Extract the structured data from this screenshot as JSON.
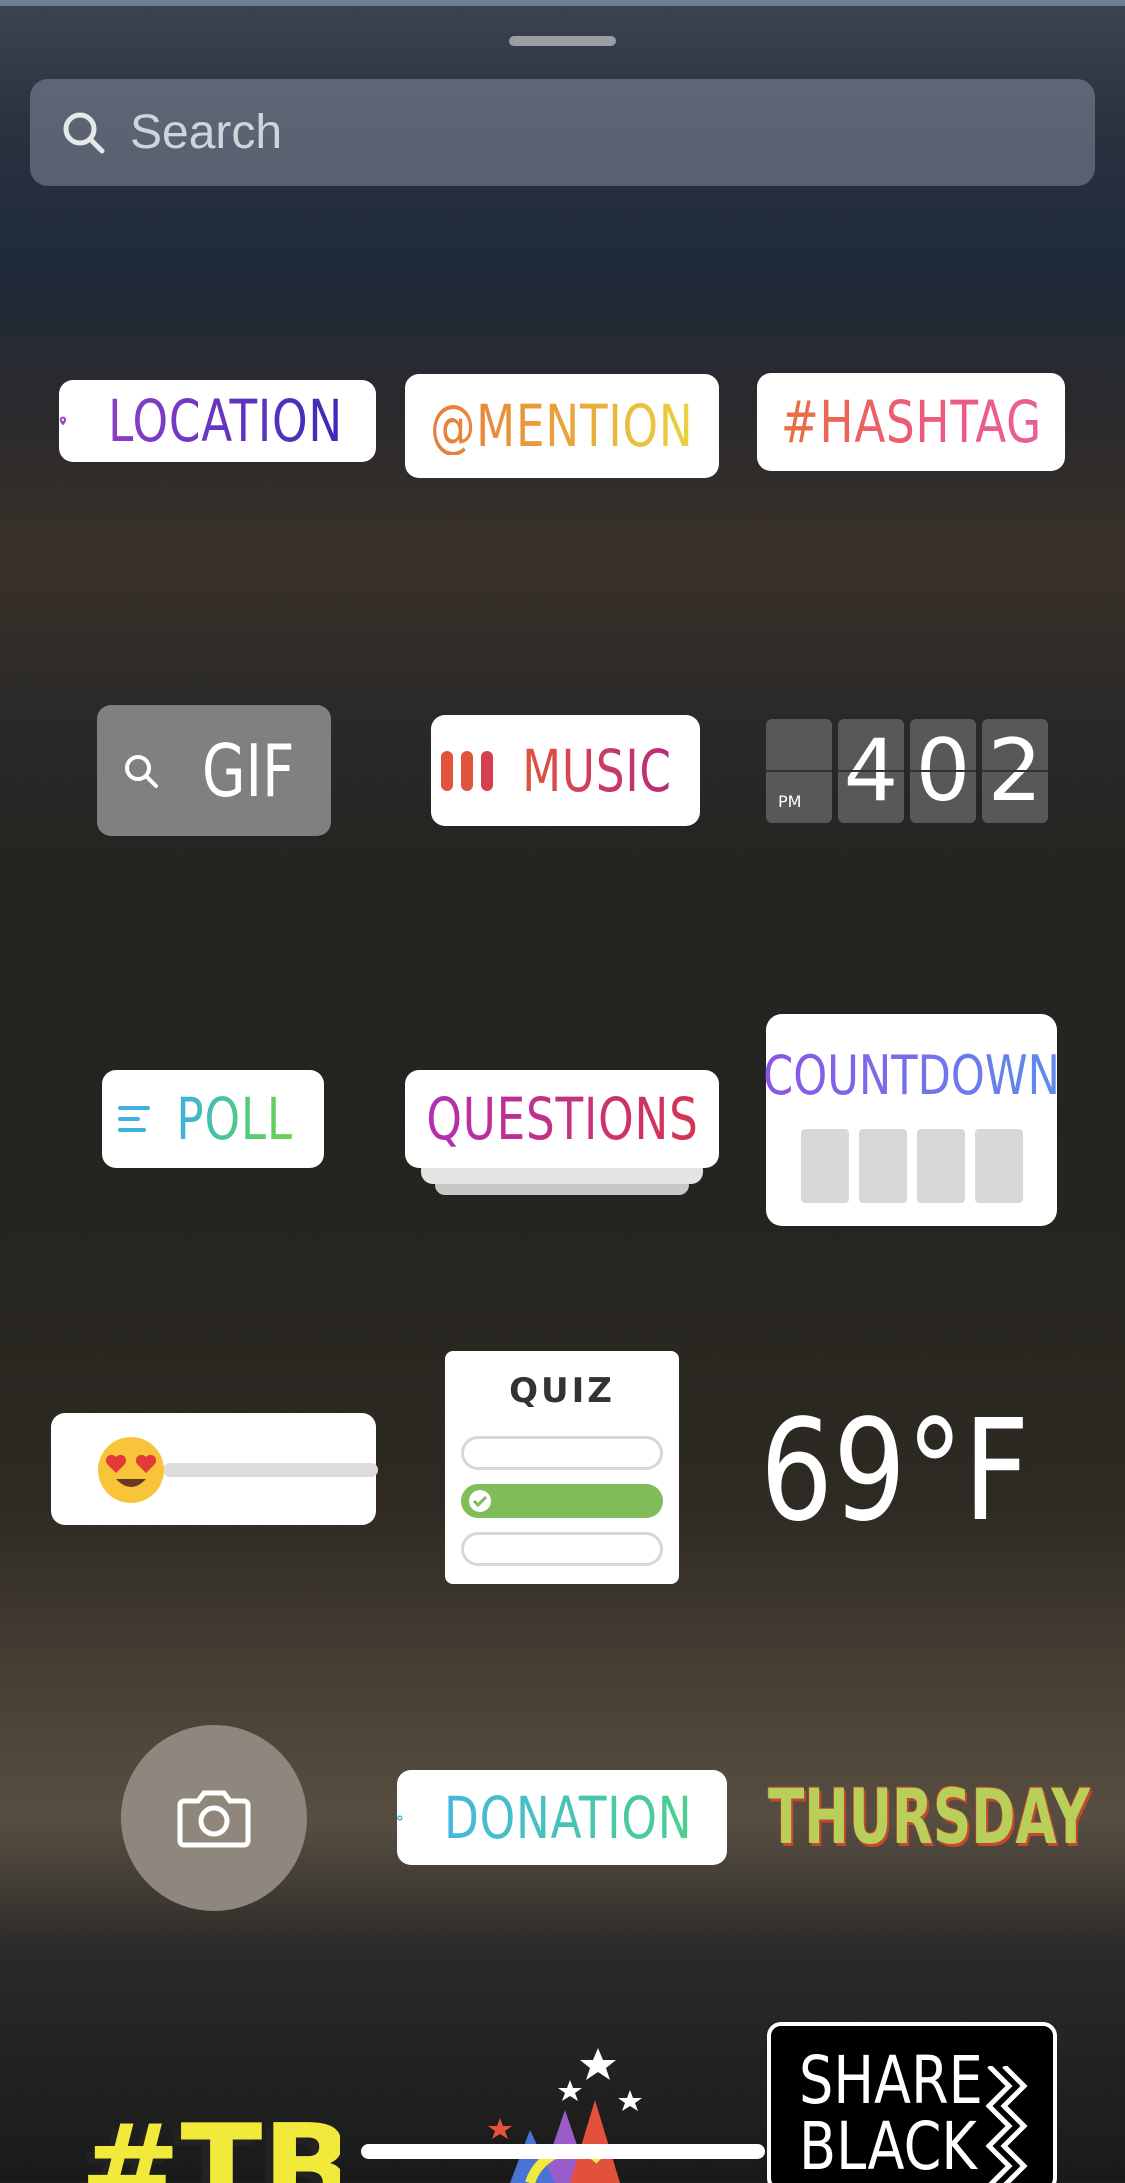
{
  "search": {
    "placeholder": "Search"
  },
  "stickers": {
    "location": "LOCATION",
    "mention": "@MENTION",
    "hashtag": "#HASHTAG",
    "gif": "GIF",
    "music": "MUSIC",
    "clock": {
      "ampm": "PM",
      "d1": "4",
      "d2": "0",
      "d3": "2"
    },
    "poll": "POLL",
    "questions": "QUESTIONS",
    "countdown": "COUNTDOWN",
    "quiz": "QUIZ",
    "temperature": "69°F",
    "donation": "DONATION",
    "day": "THURSDAY",
    "tbt": "#TBT",
    "share_black": "SHARE BLACK"
  },
  "colors": {
    "location_accent": "#8c3fc7",
    "quiz_correct": "#80bd5a",
    "donation_accent": "#45b7e0"
  }
}
